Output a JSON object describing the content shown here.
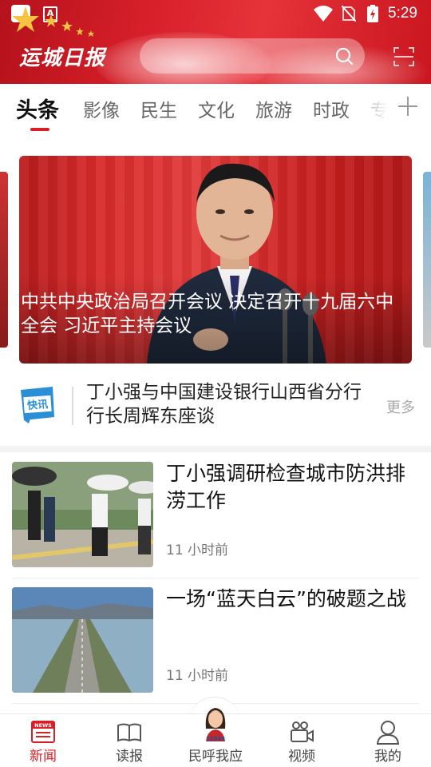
{
  "status_bar": {
    "time": "5:29"
  },
  "header": {
    "logo_text": "运城日报",
    "search_placeholder": ""
  },
  "tabs": [
    {
      "label": "头条",
      "active": true
    },
    {
      "label": "影像"
    },
    {
      "label": "民生"
    },
    {
      "label": "文化"
    },
    {
      "label": "旅游"
    },
    {
      "label": "时政"
    },
    {
      "label": "专"
    }
  ],
  "banner": {
    "caption": "中共中央政治局召开会议 决定召开十九届六中全会 习近平主持会议"
  },
  "flash": {
    "logo_text": "快讯",
    "headline": "丁小强与中国建设银行山西省分行行长周辉东座谈",
    "more_label": "更多"
  },
  "news": [
    {
      "title": "丁小强调研检查城市防洪排涝工作",
      "time": "11 小时前"
    },
    {
      "title": "一场“蓝天白云”的破题之战",
      "time": "11 小时前"
    }
  ],
  "bottom_nav": {
    "items": [
      {
        "label": "新闻",
        "icon": "news-icon",
        "active": true
      },
      {
        "label": "读报",
        "icon": "newspaper-icon"
      },
      {
        "label": "民呼我应",
        "icon": "hotline-avatar-icon",
        "badge": "12345"
      },
      {
        "label": "视频",
        "icon": "video-icon"
      },
      {
        "label": "我的",
        "icon": "profile-icon"
      }
    ]
  },
  "colors": {
    "brand_red": "#d62026",
    "header_red": "#d8202a"
  }
}
